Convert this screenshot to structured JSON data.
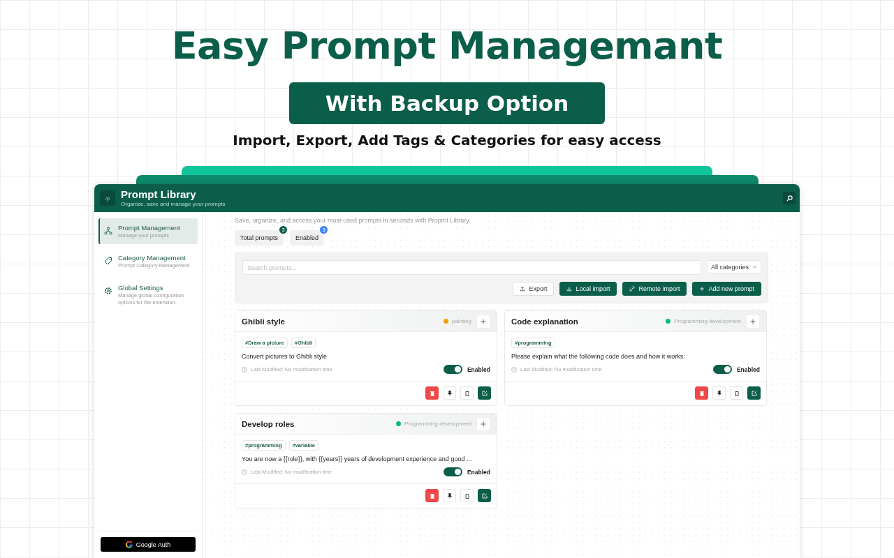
{
  "hero": {
    "title": "Easy Prompt Managemant",
    "badge": "With Backup Option",
    "subtitle": "Import, Export, Add Tags & Categories for easy access"
  },
  "app": {
    "title": "Prompt Library",
    "subtitle": "Organize, save and manage your prompts",
    "logo": "/p"
  },
  "sidebar": {
    "items": [
      {
        "title": "Prompt Management",
        "description": "Manage your prompts",
        "selected": true
      },
      {
        "title": "Category Management",
        "description": "Prompt Category Management",
        "selected": false
      },
      {
        "title": "Global Settings",
        "description": "Manage global configuration options for the extension.",
        "selected": false
      }
    ],
    "auth_button": "Google Auth"
  },
  "main": {
    "intro": "Save, organize, and access your most-used prompts in seconds with Propmt Library.",
    "stats": [
      {
        "label": "Total prompts",
        "count": "3",
        "color": "#0b5e4a"
      },
      {
        "label": "Enabled",
        "count": "3",
        "color": "#3b82f6"
      }
    ],
    "search": {
      "placeholder": "Search prompts..."
    },
    "category_filter": "All categories",
    "actions": [
      {
        "label": "Export",
        "kind": "outline"
      },
      {
        "label": "Local import",
        "kind": "primary"
      },
      {
        "label": "Remote import",
        "kind": "primary"
      },
      {
        "label": "Add new prompt",
        "kind": "primary"
      }
    ]
  },
  "cards": [
    {
      "title": "Ghibli style",
      "category": "painting",
      "color": "#f59e0b",
      "tags": [
        "#Draw a picture",
        "#Ghibli"
      ],
      "text": "Convert pictures to Ghibli style",
      "modified": "Last Modified: No modification time",
      "enabled": true,
      "status": "Enabled"
    },
    {
      "title": "Code explanation",
      "category": "Programming development",
      "color": "#10b981",
      "tags": [
        "#programming"
      ],
      "text": "Please explain what the following code does and how it works:",
      "modified": "Last Modified: No modification time",
      "enabled": true,
      "status": "Enabled"
    },
    {
      "title": "Develop roles",
      "category": "Programming development",
      "color": "#10b981",
      "tags": [
        "#programming",
        "#variable"
      ],
      "text": "You are now a {{role}}, with {{years}} years of development experience and good ...",
      "modified": "Last Modified: No modification time",
      "enabled": true,
      "status": "Enabled"
    }
  ]
}
